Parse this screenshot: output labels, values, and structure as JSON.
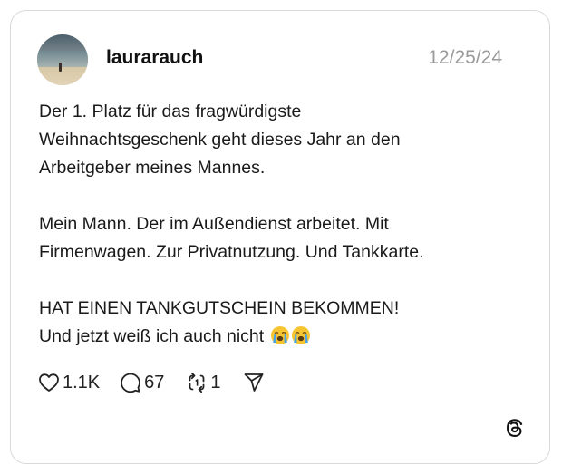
{
  "post": {
    "author": {
      "username": "laurarauch"
    },
    "date": "12/25/24",
    "body": {
      "para1": {
        "line1": "Der 1. Platz für das fragwürdigste",
        "line2": "Weihnachtsgeschenk geht dieses Jahr an den",
        "line3": "Arbeitgeber meines Mannes."
      },
      "para2": {
        "line1": "Mein Mann. Der im Außendienst arbeitet. Mit",
        "line2": "Firmenwagen. Zur Privatnutzung. Und Tankkarte."
      },
      "para3": {
        "line1": "HAT EINEN TANKGUTSCHEIN BEKOMMEN!",
        "line2": "Und jetzt weiß ich auch nicht"
      },
      "emojis": [
        "loudly-crying-face",
        "loudly-crying-face"
      ]
    },
    "actions": {
      "likes": "1.1K",
      "replies": "67",
      "reposts": "1"
    },
    "icons": {
      "like": "heart-icon",
      "reply": "comment-bubble-icon",
      "repost": "repost-icon",
      "share": "send-icon",
      "brand": "threads-logo-icon"
    }
  },
  "colors": {
    "text": "#1a1a1a",
    "date": "#9a9a9a",
    "border": "#d9d9d9"
  }
}
